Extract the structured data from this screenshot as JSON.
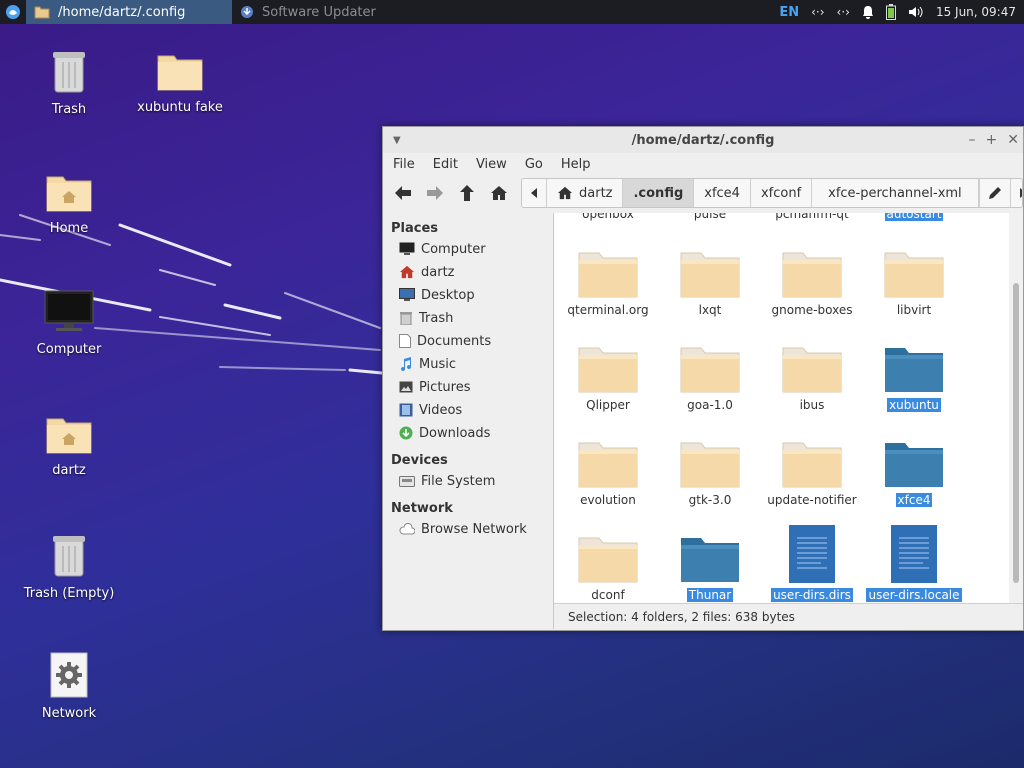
{
  "panel": {
    "tasks": [
      {
        "label": "/home/dartz/.config"
      },
      {
        "label": "Software Updater"
      }
    ],
    "lang": "EN",
    "clock": "15 Jun, 09:47"
  },
  "desktop": {
    "icons": [
      {
        "label": "Trash"
      },
      {
        "label": "xubuntu fake"
      },
      {
        "label": "Home"
      },
      {
        "label": "Computer"
      },
      {
        "label": "dartz"
      },
      {
        "label": "Trash (Empty)"
      },
      {
        "label": "Network"
      }
    ]
  },
  "window": {
    "title": "/home/dartz/.config",
    "menu": [
      "File",
      "Edit",
      "View",
      "Go",
      "Help"
    ],
    "breadcrumbs": [
      "dartz",
      ".config",
      "xfce4",
      "xfconf",
      "xfce-perchannel-xml"
    ],
    "sidebar": {
      "places_header": "Places",
      "places": [
        "Computer",
        "dartz",
        "Desktop",
        "Trash",
        "Documents",
        "Music",
        "Pictures",
        "Videos",
        "Downloads"
      ],
      "devices_header": "Devices",
      "devices": [
        "File System"
      ],
      "network_header": "Network",
      "network": [
        "Browse Network"
      ]
    },
    "partial_row": [
      "openbox",
      "pulse",
      "pcmanfm-qt",
      "autostart"
    ],
    "files": [
      {
        "name": "qterminal.org",
        "type": "folder",
        "selected": false
      },
      {
        "name": "lxqt",
        "type": "folder",
        "selected": false
      },
      {
        "name": "gnome-boxes",
        "type": "folder",
        "selected": false
      },
      {
        "name": "libvirt",
        "type": "folder",
        "selected": false
      },
      {
        "name": "Qlipper",
        "type": "folder",
        "selected": false
      },
      {
        "name": "goa-1.0",
        "type": "folder",
        "selected": false
      },
      {
        "name": "ibus",
        "type": "folder",
        "selected": false
      },
      {
        "name": "xubuntu",
        "type": "folder",
        "selected": true
      },
      {
        "name": "evolution",
        "type": "folder",
        "selected": false
      },
      {
        "name": "gtk-3.0",
        "type": "folder",
        "selected": false
      },
      {
        "name": "update-notifier",
        "type": "folder",
        "selected": false
      },
      {
        "name": "xfce4",
        "type": "folder",
        "selected": true
      },
      {
        "name": "dconf",
        "type": "folder",
        "selected": false
      },
      {
        "name": "Thunar",
        "type": "folder",
        "selected": true
      },
      {
        "name": "user-dirs.dirs",
        "type": "file",
        "selected": true
      },
      {
        "name": "user-dirs.locale",
        "type": "file",
        "selected": true
      }
    ],
    "status": "Selection: 4 folders, 2 files: 638 bytes"
  }
}
